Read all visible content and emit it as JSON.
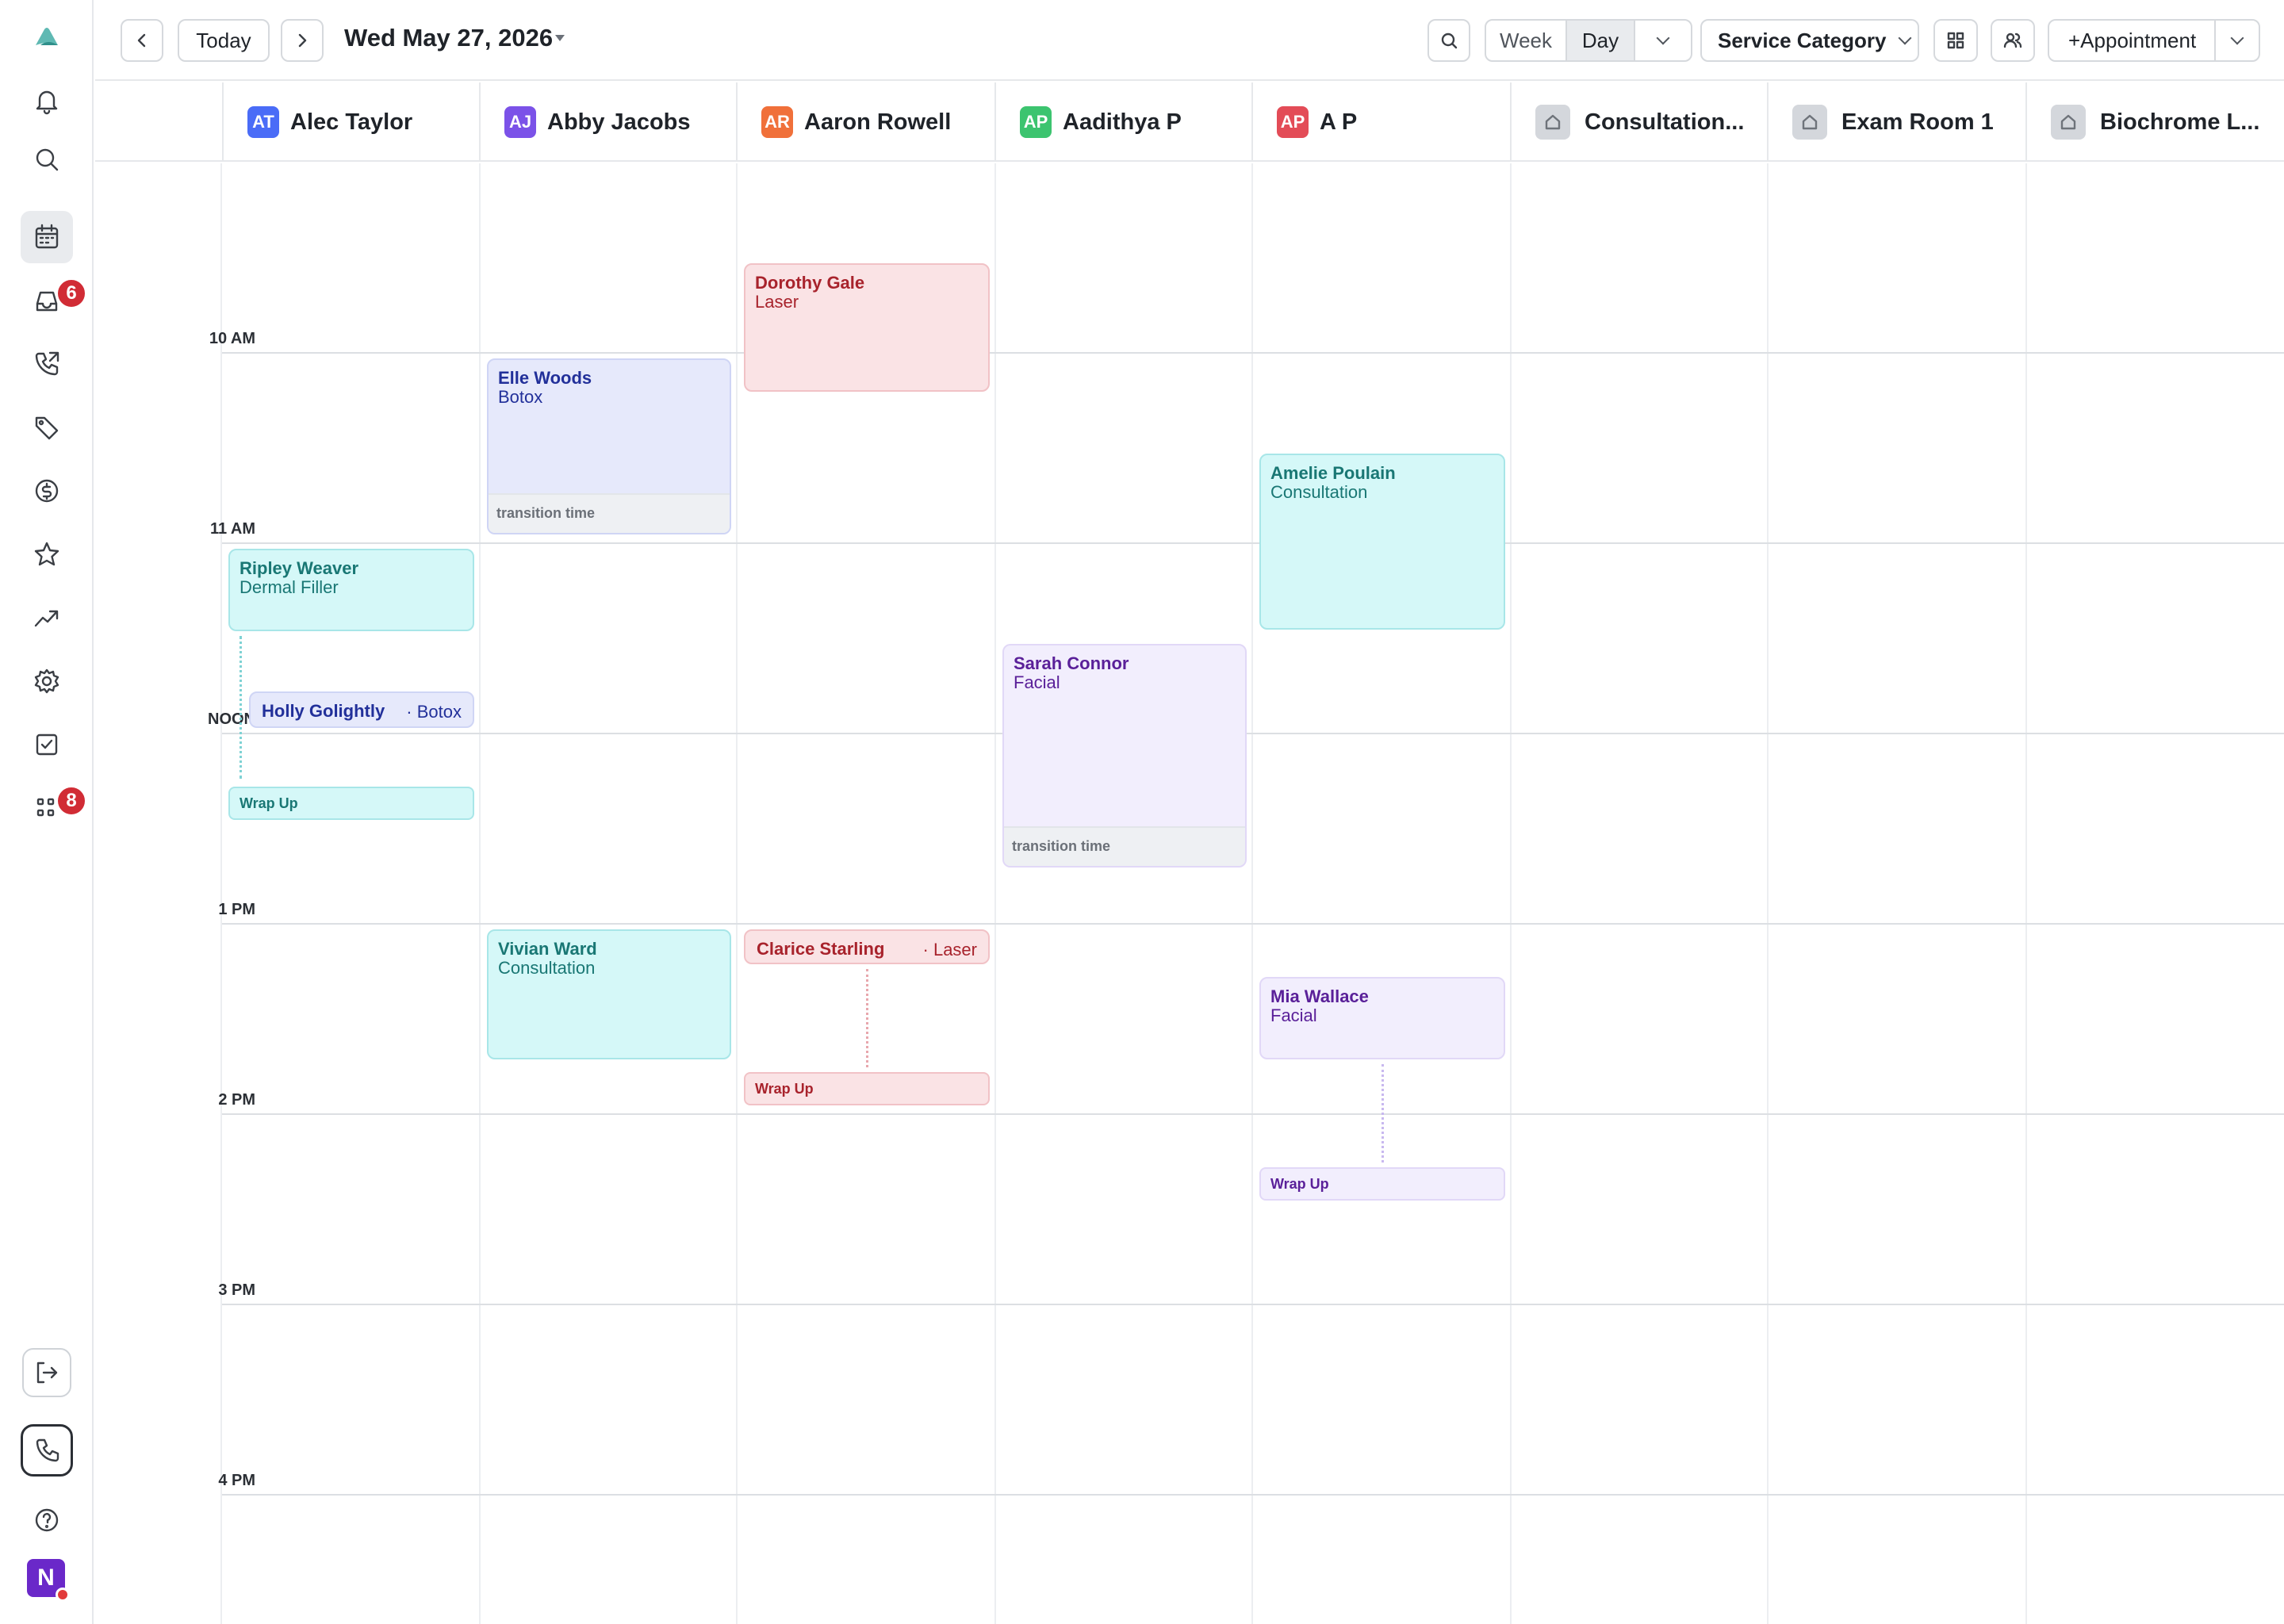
{
  "sidebar": {
    "notification_badge": "6",
    "apps_badge": "8",
    "user_initial": "N"
  },
  "toolbar": {
    "today_label": "Today",
    "date": "Wed May 27, 2026",
    "view_week": "Week",
    "view_day": "Day",
    "filter_label": "Service Category",
    "add_appointment_label": "+Appointment"
  },
  "columns": [
    {
      "initials": "AT",
      "name": "Alec Taylor",
      "color": "#4a6cf7"
    },
    {
      "initials": "AJ",
      "name": "Abby Jacobs",
      "color": "#7b52e8"
    },
    {
      "initials": "AR",
      "name": "Aaron Rowell",
      "color": "#f0703a"
    },
    {
      "initials": "AP",
      "name": "Aadithya P",
      "color": "#3cc46f"
    },
    {
      "initials": "AP",
      "name": "A P",
      "color": "#e34c57"
    },
    {
      "name": "Consultation...",
      "icon": "room-icon"
    },
    {
      "name": "Exam Room 1",
      "icon": "room-icon"
    },
    {
      "name": "Biochrome L...",
      "icon": "room-icon"
    }
  ],
  "times": [
    "10 AM",
    "11 AM",
    "NOON",
    "1 PM",
    "2 PM",
    "3 PM",
    "4 PM"
  ],
  "appointments": {
    "ripley": {
      "name": "Ripley Weaver",
      "service": "Dermal Filler"
    },
    "holly": {
      "name": "Holly Golightly",
      "service": "· Botox"
    },
    "alec_wrap": "Wrap Up",
    "elle": {
      "name": "Elle Woods",
      "service": "Botox",
      "transition": "transition time"
    },
    "vivian": {
      "name": "Vivian Ward",
      "service": "Consultation"
    },
    "dorothy": {
      "name": "Dorothy Gale",
      "service": "Laser"
    },
    "clarice": {
      "name": "Clarice Starling",
      "service": "· Laser"
    },
    "aaron_wrap": "Wrap Up",
    "sarah": {
      "name": "Sarah Connor",
      "service": "Facial",
      "transition": "transition time"
    },
    "amelie": {
      "name": "Amelie Poulain",
      "service": "Consultation"
    },
    "mia": {
      "name": "Mia Wallace",
      "service": "Facial"
    },
    "ap_wrap": "Wrap Up"
  },
  "colors": {
    "teal": "#d5f8f8",
    "red": "#fae3e5",
    "blue": "#e6e9fb",
    "purple": "#f2eefd",
    "badge_red": "#d12c35"
  }
}
